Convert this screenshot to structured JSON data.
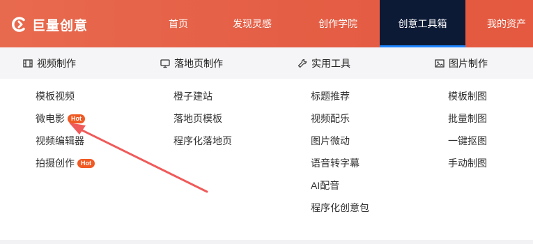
{
  "brand": {
    "logo_text": "巨量创意"
  },
  "nav": {
    "items": [
      {
        "label": "首页"
      },
      {
        "label": "发现灵感"
      },
      {
        "label": "创作学院"
      },
      {
        "label": "创意工具箱"
      },
      {
        "label": "我的资产"
      }
    ],
    "active_index": 3
  },
  "categories": [
    {
      "label": "视频制作",
      "icon": "film-icon",
      "items": [
        {
          "label": "模板视频",
          "badge": ""
        },
        {
          "label": "微电影",
          "badge": "Hot"
        },
        {
          "label": "视频编辑器",
          "badge": ""
        },
        {
          "label": "拍摄创作",
          "badge": "Hot"
        }
      ]
    },
    {
      "label": "落地页制作",
      "icon": "monitor-icon",
      "items": [
        {
          "label": "橙子建站",
          "badge": ""
        },
        {
          "label": "落地页模板",
          "badge": ""
        },
        {
          "label": "程序化落地页",
          "badge": ""
        }
      ]
    },
    {
      "label": "实用工具",
      "icon": "wrench-icon",
      "items": [
        {
          "label": "标题推荐",
          "badge": ""
        },
        {
          "label": "视频配乐",
          "badge": ""
        },
        {
          "label": "图片微动",
          "badge": ""
        },
        {
          "label": "语音转字幕",
          "badge": ""
        },
        {
          "label": "AI配音",
          "badge": ""
        },
        {
          "label": "程序化创意包",
          "badge": ""
        }
      ]
    },
    {
      "label": "图片制作",
      "icon": "image-icon",
      "items": [
        {
          "label": "模板制图",
          "badge": ""
        },
        {
          "label": "批量制图",
          "badge": ""
        },
        {
          "label": "一键抠图",
          "badge": ""
        },
        {
          "label": "手动制图",
          "badge": ""
        }
      ]
    }
  ],
  "colors": {
    "topbar": "#e4593f",
    "active_nav_bg": "#0c1a36",
    "active_nav_underline": "#1f86ff",
    "hot_badge": "#f05a24",
    "annotation_arrow": "#f05a5a"
  }
}
